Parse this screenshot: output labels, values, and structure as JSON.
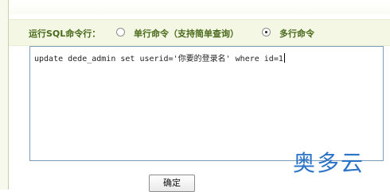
{
  "sql_form": {
    "row_label": "运行SQL命令行：",
    "single_line_label": "单行命令（支持简单查询）",
    "multi_line_label": "多行命令",
    "selected_mode": "多行命令",
    "sql_text": "update dede_admin set userid='你要的登录名' where id=1",
    "submit_label": "确定"
  },
  "watermark": {
    "text": "奥多云",
    "color": "#2a73c6"
  },
  "colors": {
    "label_green": "#4a6a1b",
    "row_background": "#f4f7e4",
    "textarea_border": "#7f9db9"
  }
}
